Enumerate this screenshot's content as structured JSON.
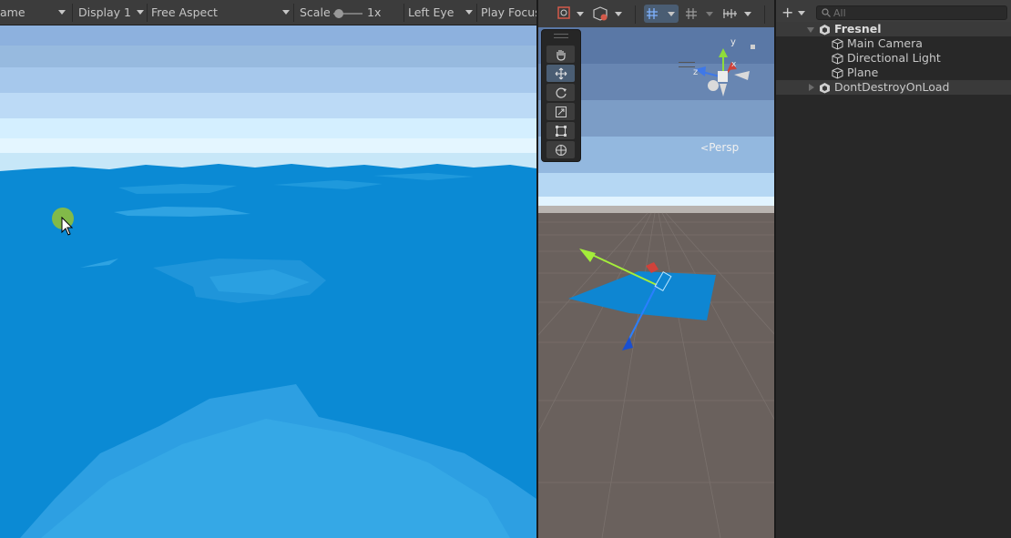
{
  "game_toolbar": {
    "display_name_partial": "ame",
    "display": "Display 1",
    "aspect": "Free Aspect",
    "scale_label": "Scale",
    "scale_value": "1x",
    "eye": "Left Eye",
    "play_focus": "Play Focus"
  },
  "scene": {
    "persp_label": "Persp",
    "axis_x": "x",
    "axis_y": "y",
    "axis_z": "z"
  },
  "hierarchy": {
    "search_placeholder": "All",
    "rows": [
      {
        "label": "Fresnel"
      },
      {
        "label": "Main Camera"
      },
      {
        "label": "Directional Light"
      },
      {
        "label": "Plane"
      },
      {
        "label": "DontDestroyOnLoad"
      }
    ]
  },
  "colors": {
    "ocean": "#0a8ad4",
    "sky_top": "#8cb0dd",
    "horizon": "#d7f2ff",
    "ground": "#6b625f",
    "accent_active": "#4a5d73"
  }
}
